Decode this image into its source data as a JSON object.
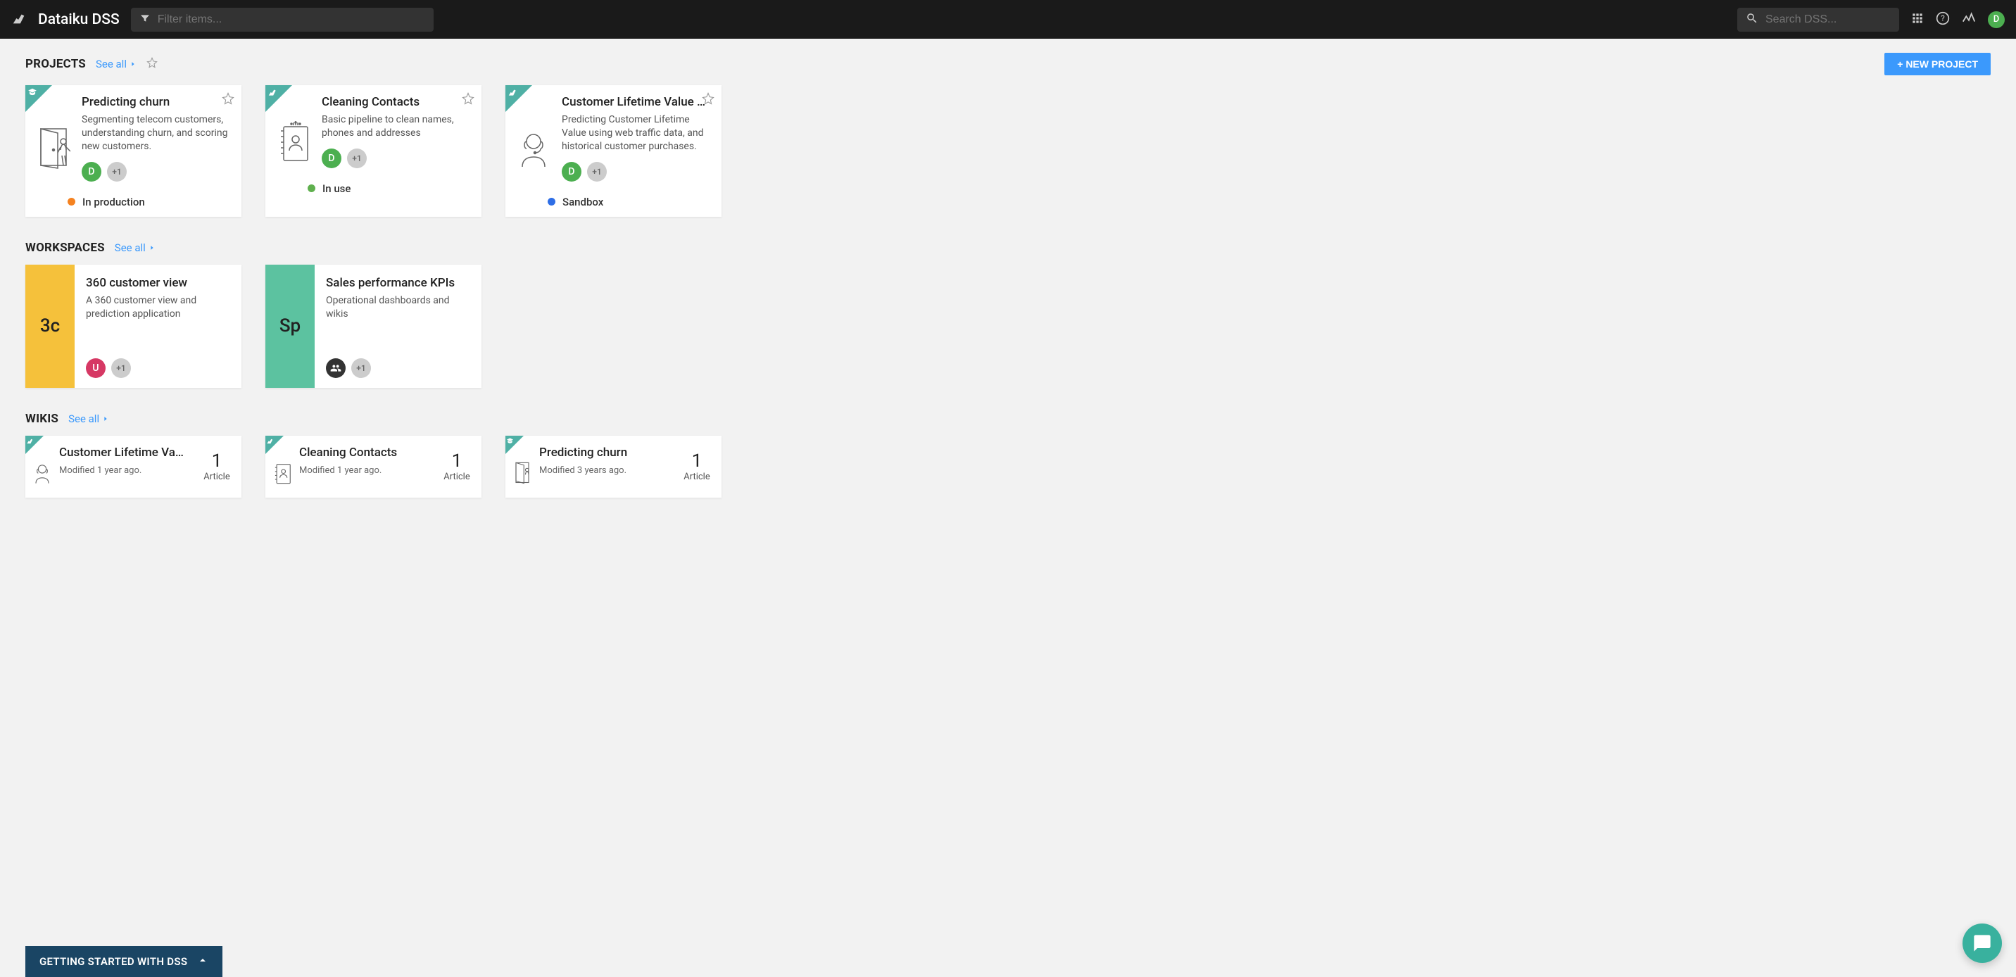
{
  "header": {
    "app_title": "Dataiku DSS",
    "filter_placeholder": "Filter items...",
    "search_placeholder": "Search DSS...",
    "user_initial": "D"
  },
  "new_project_label": "+ NEW PROJECT",
  "see_all_label": "See all",
  "sections": {
    "projects": {
      "title": "PROJECTS"
    },
    "workspaces": {
      "title": "WORKSPACES"
    },
    "wikis": {
      "title": "WIKIS"
    }
  },
  "projects": [
    {
      "title": "Predicting churn",
      "desc": "Segmenting telecom customers, understanding churn, and scoring new customers.",
      "avatar_initial": "D",
      "avatar_color": "green",
      "more": "+1",
      "status": "In production",
      "status_color": "orange",
      "corner_icon": "grad"
    },
    {
      "title": "Cleaning Contacts",
      "desc": "Basic pipeline to clean names, phones and addresses",
      "avatar_initial": "D",
      "avatar_color": "green",
      "more": "+1",
      "status": "In use",
      "status_color": "green",
      "corner_icon": "bird"
    },
    {
      "title": "Customer Lifetime Value …",
      "desc": "Predicting Customer Lifetime Value using web traffic data, and historical customer purchases.",
      "avatar_initial": "D",
      "avatar_color": "green",
      "more": "+1",
      "status": "Sandbox",
      "status_color": "blue",
      "corner_icon": "bird"
    }
  ],
  "workspaces": [
    {
      "tile": "3c",
      "tile_color": "yellow",
      "title": "360 customer view",
      "desc": "A 360 customer view and prediction application",
      "avatar_initial": "U",
      "avatar_color": "pink",
      "more": "+1"
    },
    {
      "tile": "Sp",
      "tile_color": "teal",
      "title": "Sales performance KPIs",
      "desc": "Operational dashboards and wikis",
      "avatar_icon": "group",
      "more": "+1"
    }
  ],
  "wikis": [
    {
      "title": "Customer Lifetime Va…",
      "modified": "Modified 1 year ago.",
      "count": "1",
      "count_label": "Article",
      "icon": "agent",
      "corner_icon": "bird"
    },
    {
      "title": "Cleaning Contacts",
      "modified": "Modified 1 year ago.",
      "count": "1",
      "count_label": "Article",
      "icon": "contacts",
      "corner_icon": "bird"
    },
    {
      "title": "Predicting churn",
      "modified": "Modified 3 years ago.",
      "count": "1",
      "count_label": "Article",
      "icon": "door",
      "corner_icon": "grad"
    }
  ],
  "bottom_bar": "GETTING STARTED WITH DSS"
}
